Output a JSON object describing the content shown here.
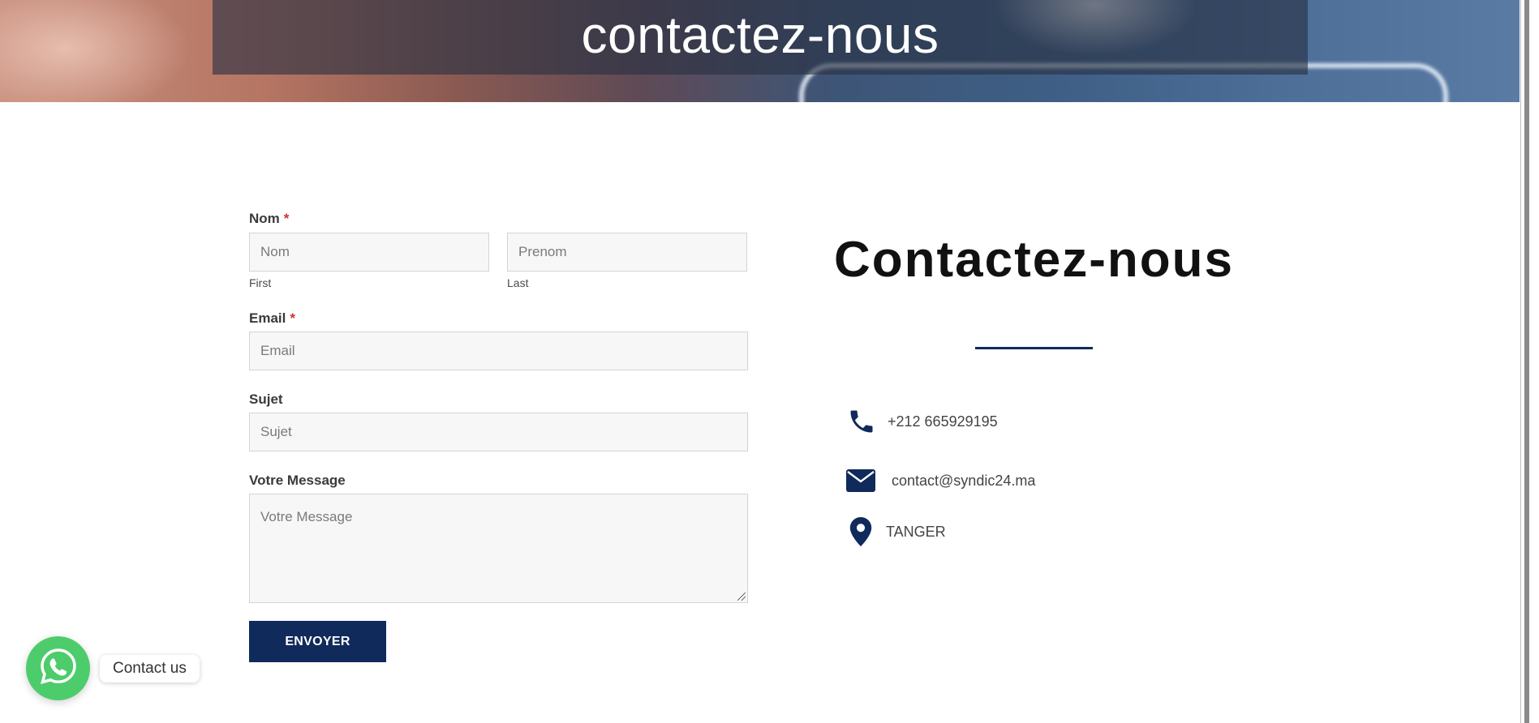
{
  "hero": {
    "title": "contactez-nous"
  },
  "form": {
    "name_label": "Nom",
    "required_mark": "*",
    "first_placeholder": "Nom",
    "first_sublabel": "First",
    "last_placeholder": "Prenom",
    "last_sublabel": "Last",
    "email_label": "Email",
    "email_placeholder": "Email",
    "subject_label": "Sujet",
    "subject_placeholder": "Sujet",
    "message_label": "Votre Message",
    "message_placeholder": "Votre Message",
    "submit_label": "ENVOYER"
  },
  "contact": {
    "title": "Contactez-nous",
    "phone": "+212 665929195",
    "email": "contact@syndic24.ma",
    "location": "TANGER",
    "icons": [
      "phone-icon",
      "envelope-icon",
      "map-pin-icon"
    ]
  },
  "whatsapp": {
    "label": "Contact us",
    "icon": "whatsapp-icon"
  },
  "colors": {
    "accent": "#0f2a5b",
    "whatsapp": "#4dcc6b",
    "required": "#d0312d"
  }
}
